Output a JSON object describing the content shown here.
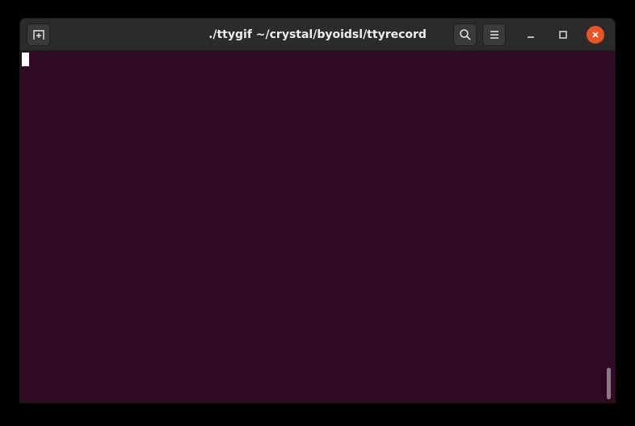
{
  "window": {
    "title": "./ttygif ~/crystal/byoidsl/ttyrecord"
  },
  "titlebar": {
    "new_tab_icon": "new-tab-icon",
    "search_icon": "search-icon",
    "menu_icon": "hamburger-menu-icon",
    "minimize_icon": "minimize-icon",
    "maximize_icon": "maximize-icon",
    "close_icon": "close-icon"
  },
  "colors": {
    "terminal_background": "#300a24",
    "titlebar_background": "#2b2b2b",
    "close_button": "#e95420",
    "cursor": "#ffffff"
  }
}
